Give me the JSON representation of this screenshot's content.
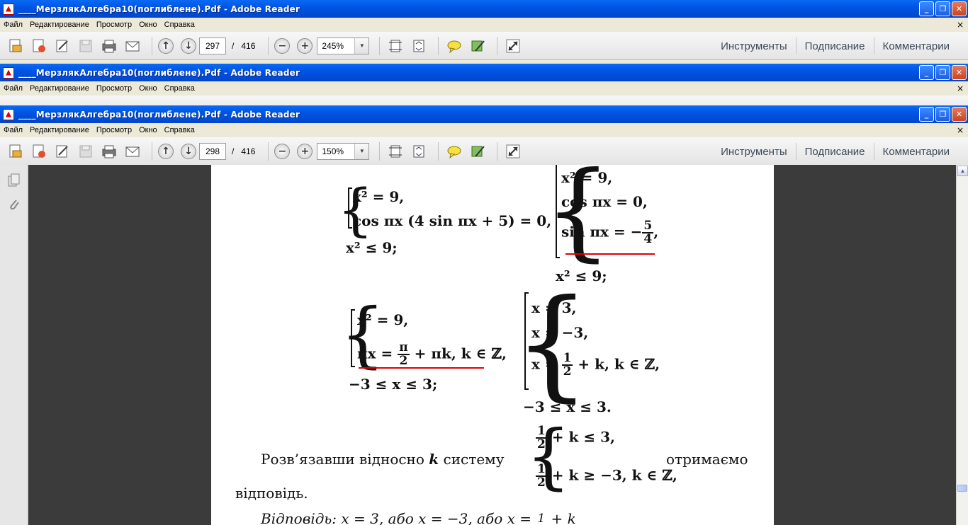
{
  "windows": [
    {
      "title": "____МерзлякАлгебра10(поглиблене).Pdf - Adobe Reader",
      "menu": [
        "Файл",
        "Редактирование",
        "Просмотр",
        "Окно",
        "Справка"
      ],
      "page_current": "297",
      "page_sep": "/",
      "page_total": "416",
      "zoom": "245%",
      "nav": [
        "Инструменты",
        "Подписание",
        "Комментарии"
      ]
    },
    {
      "title": "____МерзлякАлгебра10(поглиблене).Pdf - Adobe Reader",
      "menu": [
        "Файл",
        "Редактирование",
        "Просмотр",
        "Окно",
        "Справка"
      ]
    },
    {
      "title": "____МерзлякАлгебра10(поглиблене).Pdf - Adobe Reader",
      "menu": [
        "Файл",
        "Редактирование",
        "Просмотр",
        "Окно",
        "Справка"
      ],
      "page_current": "298",
      "page_sep": "/",
      "page_total": "416",
      "zoom": "150%",
      "nav": [
        "Инструменты",
        "Подписание",
        "Комментарии"
      ]
    }
  ],
  "document": {
    "sys1": [
      "x² = 9,",
      "cos πx (4 sin πx + 5) = 0,",
      "x² ≤ 9;"
    ],
    "sys2": [
      "x² = 9,",
      "cos πx = 0,",
      "sin πx = −",
      "5",
      "4",
      ",",
      "x² ≤ 9;"
    ],
    "sys3": [
      "x² = 9,",
      "πx = ",
      "π",
      "2",
      " + πk,  k ∈ ℤ,",
      "−3 ≤ x ≤ 3;"
    ],
    "sys4": [
      "x = 3,",
      "x = −3,",
      "x = ",
      "1",
      "2",
      " + k,  k ∈ ℤ,",
      "−3 ≤ x ≤ 3."
    ],
    "para_start": "Розв’язавши відносно",
    "para_k": "k",
    "para_sys": "систему",
    "sys5": [
      "1",
      "2",
      " + k ≤ 3,",
      "1",
      "2",
      " + k ≥ −3,   k ∈ ℤ,"
    ],
    "para_end": "отримаємо",
    "para_line2": "відповідь.",
    "answer": "Відповідь:  x = 3,  або  x = −3,  або  x = ",
    "answer_frac": "1",
    "answer_tail": " + k"
  },
  "colors": {
    "title_bar": "#0055e5",
    "underline": "#e00000",
    "workspace": "#3b3b3b"
  }
}
